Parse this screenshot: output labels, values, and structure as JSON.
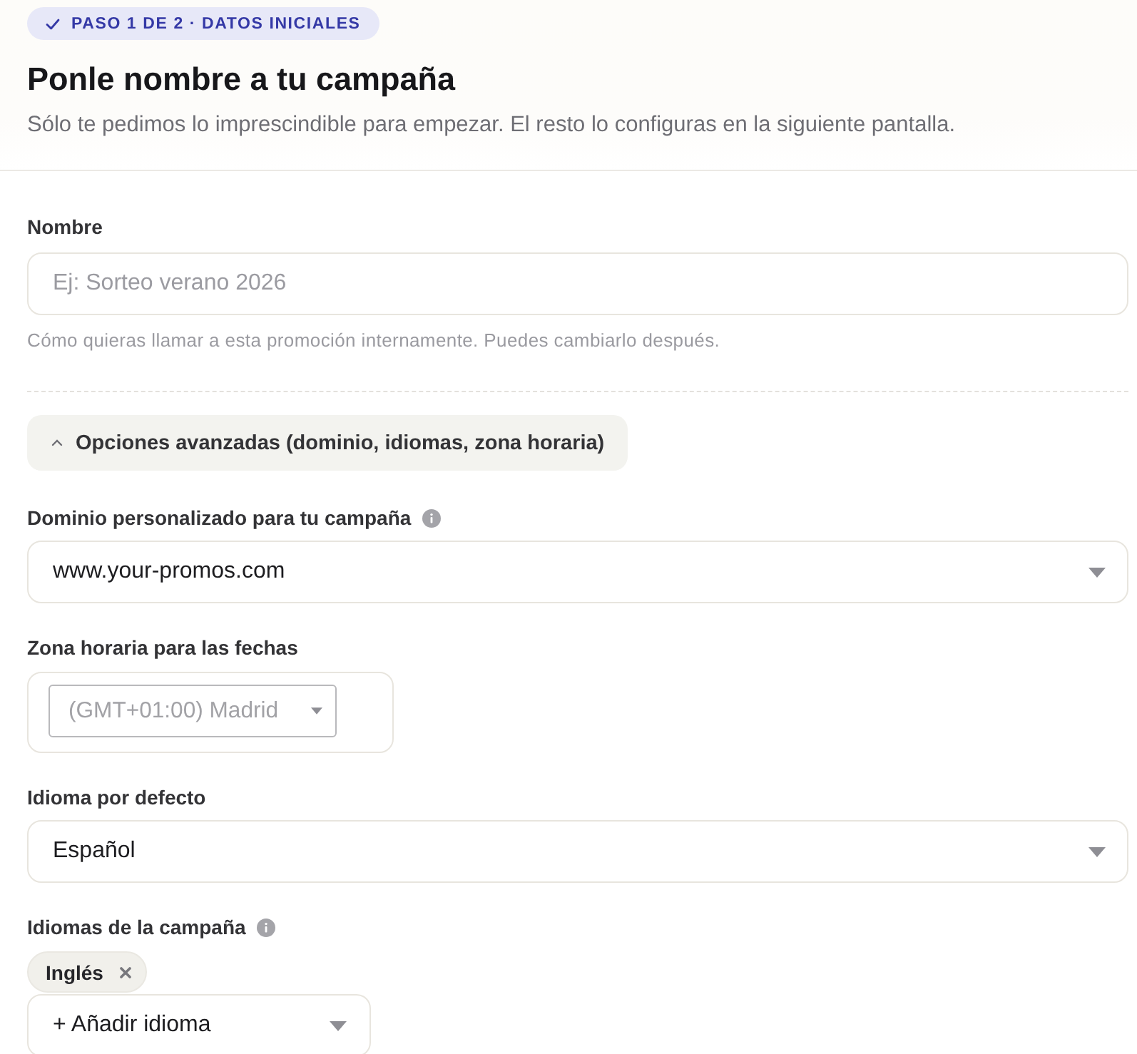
{
  "header": {
    "step_badge": "PASO 1 DE 2 · DATOS INICIALES",
    "title": "Ponle nombre a tu campaña",
    "subtitle": "Sólo te pedimos lo imprescindible para empezar. El resto lo configuras en la siguiente pantalla."
  },
  "name_field": {
    "label": "Nombre",
    "placeholder": "Ej: Sorteo verano 2026",
    "hint": "Cómo quieras llamar a esta promoción internamente. Puedes cambiarlo después."
  },
  "advanced_toggle": {
    "label": "Opciones avanzadas (dominio, idiomas, zona horaria)",
    "expanded": true
  },
  "fields": [
    {
      "kind": "select",
      "label": "Dominio personalizado para tu campaña",
      "info": true,
      "value": "www.your-promos.com"
    },
    {
      "kind": "native-select",
      "label": "Zona horaria para las fechas",
      "info": false,
      "value": "(GMT+01:00) Madrid",
      "disabled": true
    },
    {
      "kind": "select",
      "label": "Idioma por defecto",
      "info": false,
      "value": "Español"
    },
    {
      "kind": "tags",
      "label": "Idiomas de la campaña",
      "info": true,
      "tags": [
        "Inglés"
      ],
      "add_label": "+ Añadir idioma"
    }
  ]
}
